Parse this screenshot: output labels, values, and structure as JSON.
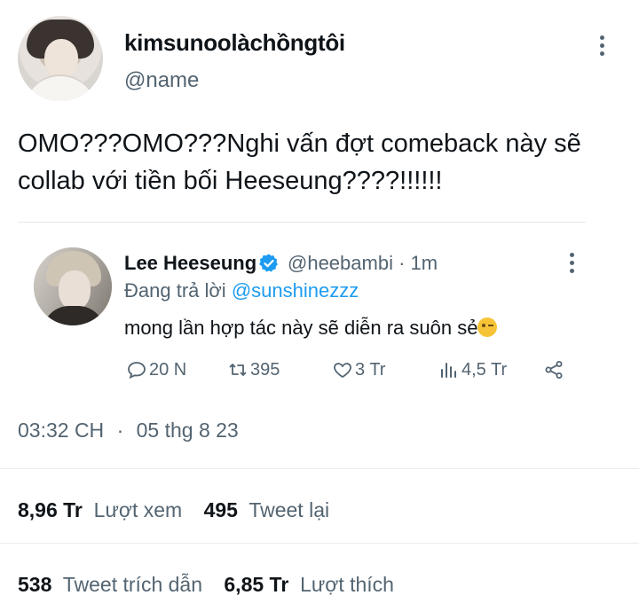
{
  "author": {
    "display_name": "kimsunoolàchồngtôi",
    "handle": "@name"
  },
  "tweet_text": "OMO???OMO???Nghi vấn đợt comeback này sẽ collab với tiền bối Heeseung????!!!!!!",
  "quote": {
    "display_name": "Lee Heeseung",
    "handle": "@heebambi",
    "separator": "·",
    "time": "1m",
    "reply_prefix": "Đang trả lời",
    "reply_mention": "@sunshinezzz",
    "text": "mong lần hợp tác này sẽ diễn ra suôn sẻ",
    "emoji_icon": "wink-emoji",
    "actions": {
      "replies": "20 N",
      "retweets": "395",
      "likes": "3 Tr",
      "views": "4,5 Tr"
    },
    "verified_color": "#1d9bf0"
  },
  "timestamp": {
    "time": "03:32 CH",
    "dot": "·",
    "date": "05 thg 8 23"
  },
  "stats": {
    "views_count": "8,96 Tr",
    "views_label": "Lượt xem",
    "retweets_count": "495",
    "retweets_label": "Tweet lại",
    "quotes_count": "538",
    "quotes_label": "Tweet trích dẫn",
    "likes_count": "6,85 Tr",
    "likes_label": "Lượt thích"
  },
  "colors": {
    "text_primary": "#0f1419",
    "text_secondary": "#536471",
    "accent": "#1d9bf0"
  }
}
